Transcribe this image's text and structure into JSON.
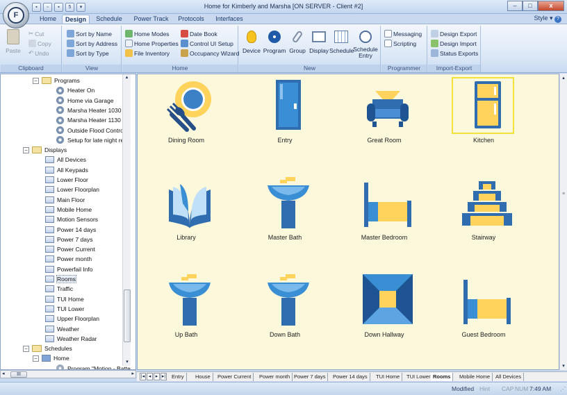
{
  "window": {
    "title": "Home for Kimberly and Marsha [ON SERVER - Client #2]",
    "orb_letter": "F",
    "qat_badge": "5",
    "controls": {
      "minimize": "–",
      "maximize": "□",
      "close": "x"
    }
  },
  "ribbon_tabs": [
    "Home",
    "Design",
    "Schedule",
    "Power Track",
    "Protocols",
    "Interfaces"
  ],
  "active_tab": "Design",
  "style_menu": "Style",
  "ribbon": {
    "clipboard": {
      "label": "Clipboard",
      "paste": "Paste",
      "cut": "Cut",
      "copy": "Copy",
      "undo": "Undo"
    },
    "view": {
      "label": "View",
      "sort_name": "Sort by Name",
      "sort_address": "Sort by Address",
      "sort_type": "Sort by Type"
    },
    "home": {
      "label": "Home",
      "home_modes": "Home Modes",
      "home_properties": "Home Properties",
      "file_inventory": "File Inventory",
      "date_book": "Date Book",
      "control_ui_setup": "Control UI Setup",
      "occupancy_wizard": "Occupancy Wizard"
    },
    "new": {
      "label": "New",
      "device": "Device",
      "program": "Program",
      "group": "Group",
      "display": "Display",
      "schedule": "Schedule",
      "schedule_entry_1": "Schedule",
      "schedule_entry_2": "Entry"
    },
    "programmer": {
      "label": "Programmer",
      "messaging": "Messaging",
      "scripting": "Scripting"
    },
    "import_export": {
      "label": "Import-Export",
      "design_export": "Design Export",
      "design_import": "Design Import",
      "status_exports": "Status Exports"
    }
  },
  "tree": {
    "programs_label": "Programs",
    "programs": [
      "Heater On",
      "Home via Garage",
      "Marsha Heater 1030",
      "Marsha Heater 1130",
      "Outside Flood Control",
      "Setup for late night retur"
    ],
    "displays_label": "Displays",
    "displays": [
      "All Devices",
      "All Keypads",
      "Lower Floor",
      "Lower Floorplan",
      "Main Floor",
      "Mobile Home",
      "Motion Sensors",
      "Power 14 days",
      "Power 7 days",
      "Power Current",
      "Power month",
      "Powerfail Info",
      "Rooms",
      "Traffic",
      "TUI Home",
      "TUI Lower",
      "Upper Floorplan",
      "Weather",
      "Weather Radar"
    ],
    "selected_display": "Rooms",
    "schedules_label": "Schedules",
    "schedule_home": "Home",
    "schedule_program": "Program \"Motion - Batte"
  },
  "rooms": [
    {
      "label": "Dining Room",
      "icon": "dining-icon"
    },
    {
      "label": "Entry",
      "icon": "door-icon"
    },
    {
      "label": "Great Room",
      "icon": "armchair-icon"
    },
    {
      "label": "Kitchen",
      "icon": "fridge-icon",
      "selected": true
    },
    {
      "label": "Library",
      "icon": "book-icon"
    },
    {
      "label": "Master Bath",
      "icon": "sink-icon"
    },
    {
      "label": "Master Bedroom",
      "icon": "bed-icon"
    },
    {
      "label": "Stairway",
      "icon": "stairs-icon"
    },
    {
      "label": "Up Bath",
      "icon": "sink-icon"
    },
    {
      "label": "Down Bath",
      "icon": "sink-icon"
    },
    {
      "label": "Down Hallway",
      "icon": "hallway-icon"
    },
    {
      "label": "Guest Bedroom",
      "icon": "bed-icon"
    }
  ],
  "sheet_tabs": [
    "Entry",
    "House",
    "Power Current",
    "Power month",
    "Power 7 days",
    "Power 14 days",
    "TUI Home",
    "TUI Lower",
    "Rooms",
    "Mobile Home",
    "All Devices"
  ],
  "active_sheet": "Rooms",
  "hscroll_label": "III",
  "status": {
    "modified": "Modified",
    "hint": "Hint",
    "cap": "CAP",
    "num": "NUM",
    "time": "7:49 AM"
  },
  "colors": {
    "icon_blue": "#2f6db0",
    "icon_yellow": "#ffd35c",
    "canvas": "#fcf8dc",
    "selection": "#f2e23a"
  }
}
